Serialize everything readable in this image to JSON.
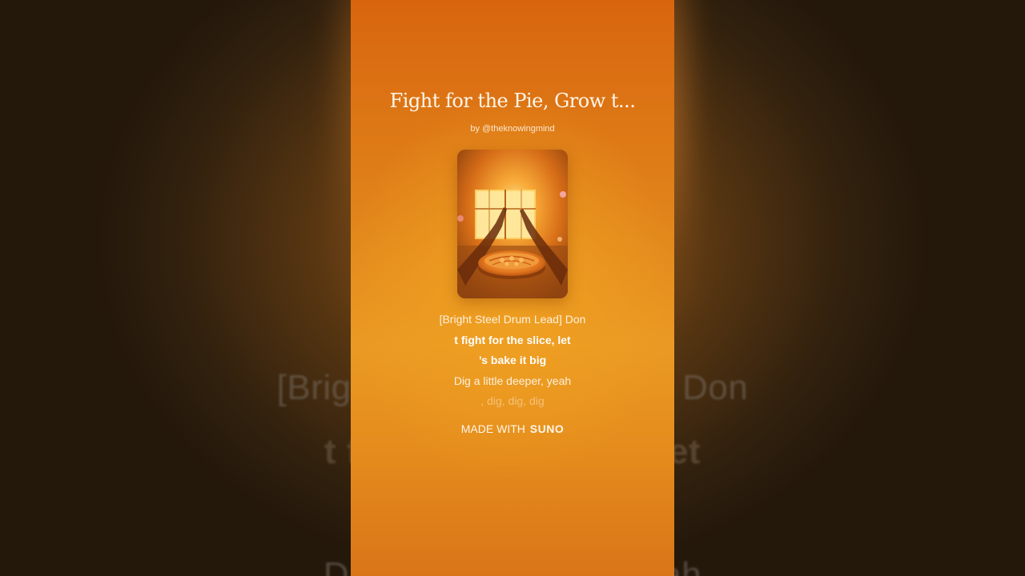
{
  "song": {
    "title": "Fight for the Pie, Grow t...",
    "byline": "by @theknowingmind"
  },
  "lyrics": [
    "[Bright Steel Drum Lead] Don",
    "t fight for the slice, let",
    "’s bake it big",
    "Dig a little deeper, yeah",
    ", dig, dig, dig"
  ],
  "footer": {
    "made_with": "MADE WITH",
    "brand": "SUNO"
  },
  "background_lyrics": [
    "[Bright Steel Drum Lead] Don",
    "t fight for the slice, let",
    "Dig a little deeper, yeah"
  ],
  "colors": {
    "card_top": "#d8650e",
    "card_mid": "#ea9a24",
    "text": "#fff6ea"
  }
}
